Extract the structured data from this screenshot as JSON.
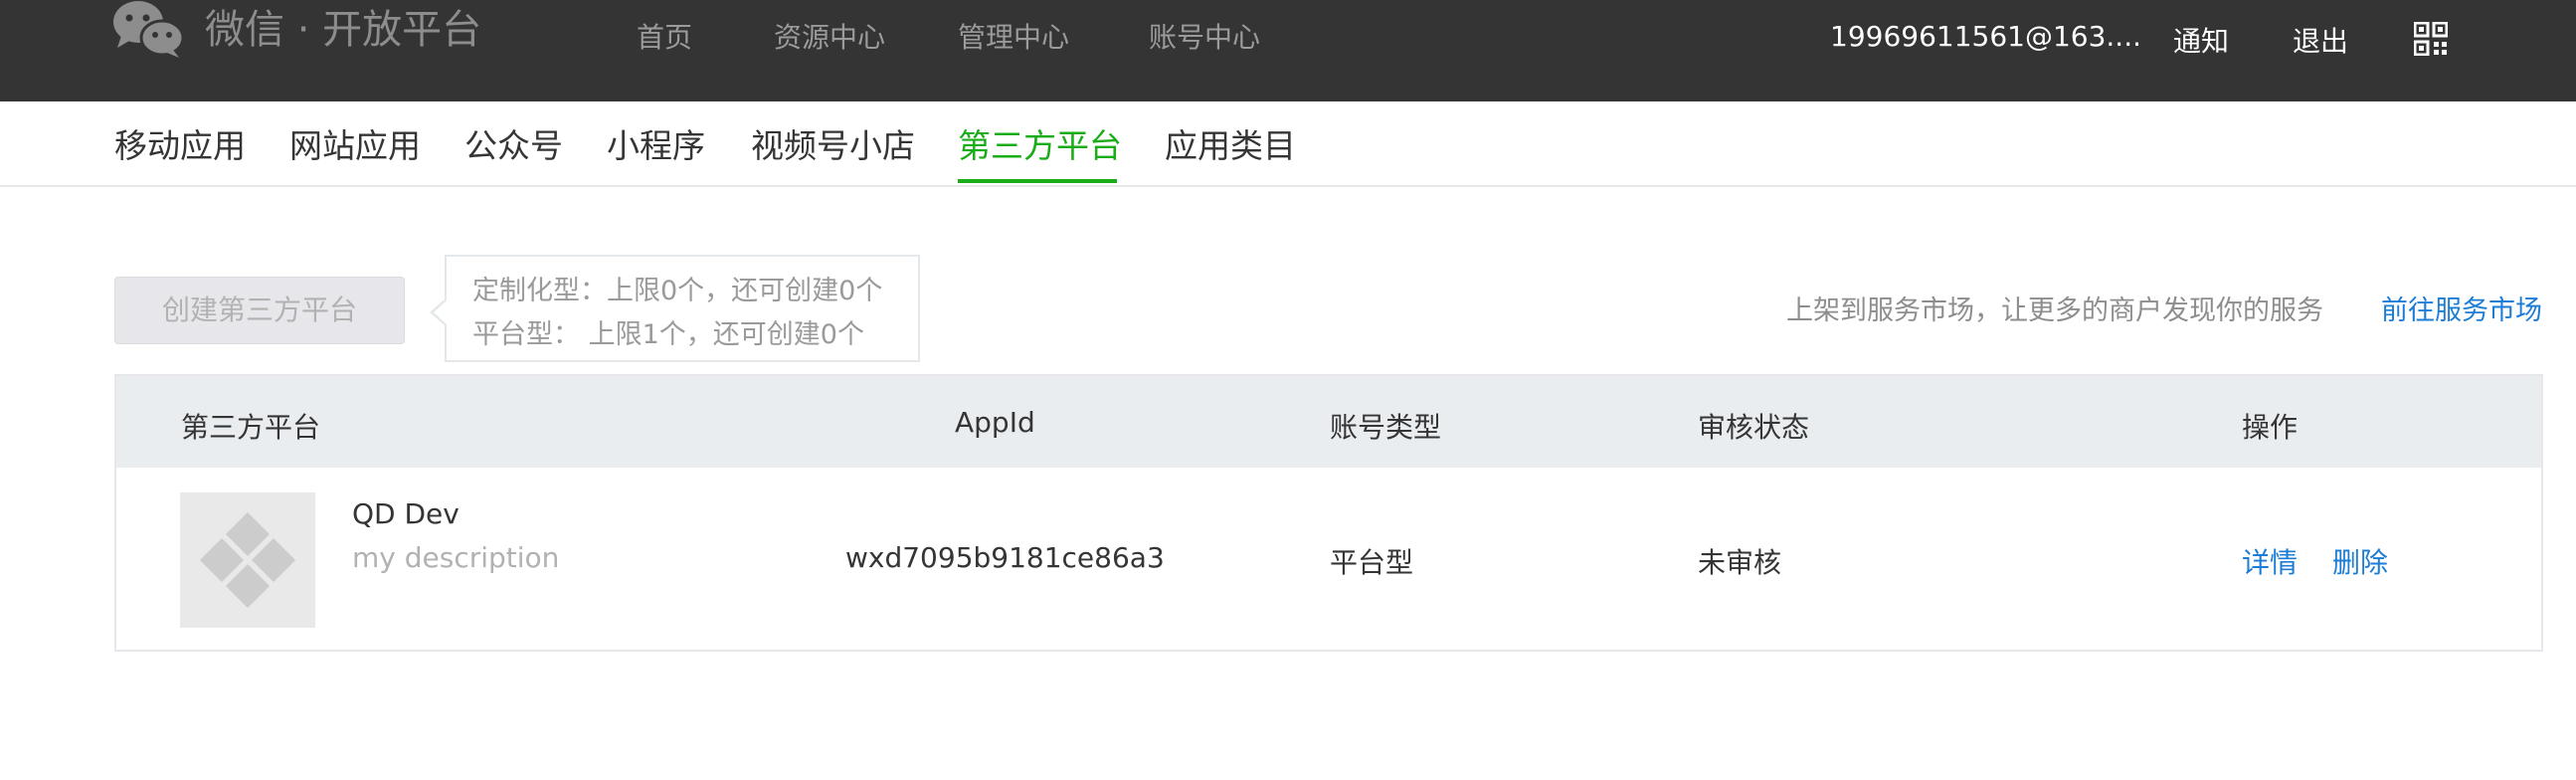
{
  "topbar": {
    "logo_text": "微信 · 开放平台",
    "nav": [
      "首页",
      "资源中心",
      "管理中心",
      "账号中心"
    ],
    "user": "19969611561@163....",
    "notify": "通知",
    "logout": "退出",
    "qr_icon": "qrcode-icon"
  },
  "tabs": [
    "移动应用",
    "网站应用",
    "公众号",
    "小程序",
    "视频号小店",
    "第三方平台",
    "应用类目"
  ],
  "active_tab": "第三方平台",
  "toolbar": {
    "create_label": "创建第三方平台",
    "tip_line1": "定制化型：上限0个，还可创建0个",
    "tip_line2": "平台型：  上限1个，还可创建0个",
    "market_text": "上架到服务市场，让更多的商户发现你的服务",
    "market_link": "前往服务市场"
  },
  "table": {
    "headers": [
      "第三方平台",
      "AppId",
      "账号类型",
      "审核状态",
      "操作"
    ],
    "rows": [
      {
        "name": "QD Dev",
        "description": "my description",
        "appid": "wxd7095b9181ce86a3",
        "account_type": "平台型",
        "status": "未审核",
        "action_detail": "详情",
        "action_delete": "删除"
      }
    ]
  },
  "colors": {
    "topbar_bg": "#343434",
    "accent_green": "#1aad19",
    "link_blue": "#1c7dd6",
    "table_header_bg": "#e9edf0"
  }
}
